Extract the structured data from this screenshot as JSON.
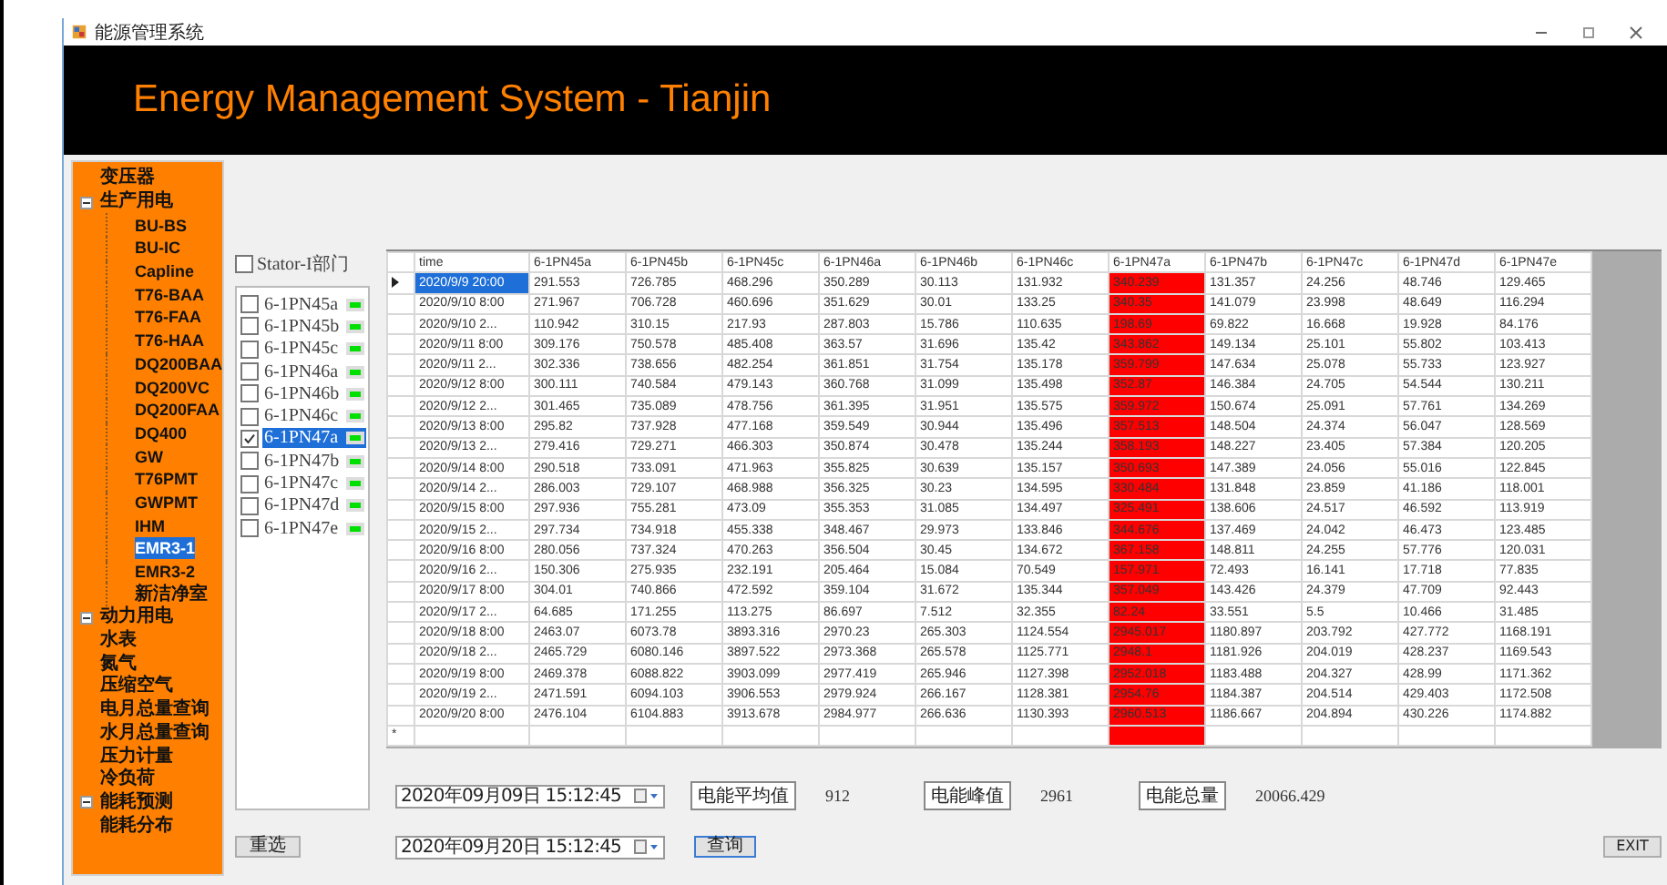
{
  "window": {
    "title": "能源管理系统",
    "banner": "Energy Management System - Tianjin"
  },
  "sidebar": {
    "items": [
      {
        "label": "变压器",
        "selected": false
      },
      {
        "label": "生产用电",
        "selected": false,
        "expanded": true,
        "children": [
          {
            "label": "BU-BS",
            "selected": false
          },
          {
            "label": "BU-IC",
            "selected": false
          },
          {
            "label": "Capline",
            "selected": false
          },
          {
            "label": "T76-BAA",
            "selected": false
          },
          {
            "label": "T76-FAA",
            "selected": false
          },
          {
            "label": "T76-HAA",
            "selected": false
          },
          {
            "label": "DQ200BAA",
            "selected": false
          },
          {
            "label": "DQ200VC",
            "selected": false
          },
          {
            "label": "DQ200FAA",
            "selected": false
          },
          {
            "label": "DQ400",
            "selected": false
          },
          {
            "label": "GW",
            "selected": false
          },
          {
            "label": "T76PMT",
            "selected": false
          },
          {
            "label": "GWPMT",
            "selected": false
          },
          {
            "label": "IHM",
            "selected": false
          },
          {
            "label": "EMR3-1",
            "selected": true
          },
          {
            "label": "EMR3-2",
            "selected": false
          },
          {
            "label": "新洁净室",
            "selected": false
          }
        ]
      },
      {
        "label": "动力用电",
        "selected": false,
        "expanded": true
      },
      {
        "label": "水表",
        "selected": false
      },
      {
        "label": "氮气",
        "selected": false
      },
      {
        "label": "压缩空气",
        "selected": false
      },
      {
        "label": "电月总量查询",
        "selected": false
      },
      {
        "label": "水月总量查询",
        "selected": false
      },
      {
        "label": "压力计量",
        "selected": false
      },
      {
        "label": "冷负荷",
        "selected": false
      },
      {
        "label": "能耗预测",
        "selected": false,
        "expanded": true
      },
      {
        "label": "能耗分布",
        "selected": false
      }
    ]
  },
  "department": {
    "label": "Stator-I部门",
    "checked": false
  },
  "devices": [
    {
      "label": "6-1PN45a",
      "checked": false,
      "selected": false
    },
    {
      "label": "6-1PN45b",
      "checked": false,
      "selected": false
    },
    {
      "label": "6-1PN45c",
      "checked": false,
      "selected": false
    },
    {
      "label": "6-1PN46a",
      "checked": false,
      "selected": false
    },
    {
      "label": "6-1PN46b",
      "checked": false,
      "selected": false
    },
    {
      "label": "6-1PN46c",
      "checked": false,
      "selected": false
    },
    {
      "label": "6-1PN47a",
      "checked": true,
      "selected": true
    },
    {
      "label": "6-1PN47b",
      "checked": false,
      "selected": false
    },
    {
      "label": "6-1PN47c",
      "checked": false,
      "selected": false
    },
    {
      "label": "6-1PN47d",
      "checked": false,
      "selected": false
    },
    {
      "label": "6-1PN47e",
      "checked": false,
      "selected": false
    }
  ],
  "reset_button": "重选",
  "table": {
    "columns": [
      {
        "label": "time",
        "highlight": false
      },
      {
        "label": "6-1PN45a",
        "highlight": false
      },
      {
        "label": "6-1PN45b",
        "highlight": false
      },
      {
        "label": "6-1PN45c",
        "highlight": false
      },
      {
        "label": "6-1PN46a",
        "highlight": false
      },
      {
        "label": "6-1PN46b",
        "highlight": false
      },
      {
        "label": "6-1PN46c",
        "highlight": false
      },
      {
        "label": "6-1PN47a",
        "highlight": true
      },
      {
        "label": "6-1PN47b",
        "highlight": false
      },
      {
        "label": "6-1PN47c",
        "highlight": false
      },
      {
        "label": "6-1PN47d",
        "highlight": false
      },
      {
        "label": "6-1PN47e",
        "highlight": false
      }
    ],
    "rows": [
      {
        "selected": true,
        "cells": [
          "2020/9/9  20:00",
          "291.553",
          "726.785",
          "468.296",
          "350.289",
          "30.113",
          "131.932",
          "340.239",
          "131.357",
          "24.256",
          "48.746",
          "129.465"
        ]
      },
      {
        "selected": false,
        "cells": [
          "2020/9/10  8:00",
          "271.967",
          "706.728",
          "460.696",
          "351.629",
          "30.01",
          "133.25",
          "340.35",
          "141.079",
          "23.998",
          "48.649",
          "116.294"
        ]
      },
      {
        "selected": false,
        "cells": [
          "2020/9/10  2...",
          "110.942",
          "310.15",
          "217.93",
          "287.803",
          "15.786",
          "110.635",
          "198.69",
          "69.822",
          "16.668",
          "19.928",
          "84.176"
        ]
      },
      {
        "selected": false,
        "cells": [
          "2020/9/11  8:00",
          "309.176",
          "750.578",
          "485.408",
          "363.57",
          "31.696",
          "135.42",
          "343.862",
          "149.134",
          "25.101",
          "55.802",
          "103.413"
        ]
      },
      {
        "selected": false,
        "cells": [
          "2020/9/11  2...",
          "302.336",
          "738.656",
          "482.254",
          "361.851",
          "31.754",
          "135.178",
          "359.799",
          "147.634",
          "25.078",
          "55.733",
          "123.927"
        ]
      },
      {
        "selected": false,
        "cells": [
          "2020/9/12  8:00",
          "300.111",
          "740.584",
          "479.143",
          "360.768",
          "31.099",
          "135.498",
          "352.87",
          "146.384",
          "24.705",
          "54.544",
          "130.211"
        ]
      },
      {
        "selected": false,
        "cells": [
          "2020/9/12  2...",
          "301.465",
          "735.089",
          "478.756",
          "361.395",
          "31.951",
          "135.575",
          "359.972",
          "150.674",
          "25.091",
          "57.761",
          "134.269"
        ]
      },
      {
        "selected": false,
        "cells": [
          "2020/9/13  8:00",
          "295.82",
          "737.928",
          "477.168",
          "359.549",
          "30.944",
          "135.496",
          "357.513",
          "148.504",
          "24.374",
          "56.047",
          "128.569"
        ]
      },
      {
        "selected": false,
        "cells": [
          "2020/9/13  2...",
          "279.416",
          "729.271",
          "466.303",
          "350.874",
          "30.478",
          "135.244",
          "358.193",
          "148.227",
          "23.405",
          "57.384",
          "120.205"
        ]
      },
      {
        "selected": false,
        "cells": [
          "2020/9/14  8:00",
          "290.518",
          "733.091",
          "471.963",
          "355.825",
          "30.639",
          "135.157",
          "350.693",
          "147.389",
          "24.056",
          "55.016",
          "122.845"
        ]
      },
      {
        "selected": false,
        "cells": [
          "2020/9/14  2...",
          "286.003",
          "729.107",
          "468.988",
          "356.325",
          "30.23",
          "134.595",
          "330.484",
          "131.848",
          "23.859",
          "41.186",
          "118.001"
        ]
      },
      {
        "selected": false,
        "cells": [
          "2020/9/15  8:00",
          "297.936",
          "755.281",
          "473.09",
          "355.353",
          "31.085",
          "134.497",
          "325.491",
          "138.606",
          "24.517",
          "46.592",
          "113.919"
        ]
      },
      {
        "selected": false,
        "cells": [
          "2020/9/15  2...",
          "297.734",
          "734.918",
          "455.338",
          "348.467",
          "29.973",
          "133.846",
          "344.676",
          "137.469",
          "24.042",
          "46.473",
          "123.485"
        ]
      },
      {
        "selected": false,
        "cells": [
          "2020/9/16  8:00",
          "280.056",
          "737.324",
          "470.263",
          "356.504",
          "30.45",
          "134.672",
          "367.158",
          "148.811",
          "24.255",
          "57.776",
          "120.031"
        ]
      },
      {
        "selected": false,
        "cells": [
          "2020/9/16  2...",
          "150.306",
          "275.935",
          "232.191",
          "205.464",
          "15.084",
          "70.549",
          "157.971",
          "72.493",
          "16.141",
          "17.718",
          "77.835"
        ]
      },
      {
        "selected": false,
        "cells": [
          "2020/9/17  8:00",
          "304.01",
          "740.866",
          "472.592",
          "359.104",
          "31.672",
          "135.344",
          "357.049",
          "143.426",
          "24.379",
          "47.709",
          "92.443"
        ]
      },
      {
        "selected": false,
        "cells": [
          "2020/9/17  2...",
          "64.685",
          "171.255",
          "113.275",
          "86.697",
          "7.512",
          "32.355",
          "82.24",
          "33.551",
          "5.5",
          "10.466",
          "31.485"
        ]
      },
      {
        "selected": false,
        "cells": [
          "2020/9/18  8:00",
          "2463.07",
          "6073.78",
          "3893.316",
          "2970.23",
          "265.303",
          "1124.554",
          "2945.017",
          "1180.897",
          "203.792",
          "427.772",
          "1168.191"
        ]
      },
      {
        "selected": false,
        "cells": [
          "2020/9/18  2...",
          "2465.729",
          "6080.146",
          "3897.522",
          "2973.368",
          "265.578",
          "1125.771",
          "2948.1",
          "1181.926",
          "204.019",
          "428.237",
          "1169.543"
        ]
      },
      {
        "selected": false,
        "cells": [
          "2020/9/19  8:00",
          "2469.378",
          "6088.822",
          "3903.099",
          "2977.419",
          "265.946",
          "1127.398",
          "2952.018",
          "1183.488",
          "204.327",
          "428.99",
          "1171.362"
        ]
      },
      {
        "selected": false,
        "cells": [
          "2020/9/19  2...",
          "2471.591",
          "6094.103",
          "3906.553",
          "2979.924",
          "266.167",
          "1128.381",
          "2954.76",
          "1184.387",
          "204.514",
          "429.403",
          "1172.508"
        ]
      },
      {
        "selected": false,
        "cells": [
          "2020/9/20  8:00",
          "2476.104",
          "6104.883",
          "3913.678",
          "2984.977",
          "266.636",
          "1130.393",
          "2960.513",
          "1186.667",
          "204.894",
          "430.226",
          "1174.882"
        ]
      }
    ],
    "new_row_marker": "*"
  },
  "date_from": "2020年09月09日 15:12:45",
  "date_to": "2020年09月20日 15:12:45",
  "stats": [
    {
      "label": "电能平均值",
      "value": "912"
    },
    {
      "label": "电能峰值",
      "value": "2961"
    },
    {
      "label": "电能总量",
      "value": "20066.429"
    }
  ],
  "query_button": "查询",
  "exit_button": "EXIT"
}
